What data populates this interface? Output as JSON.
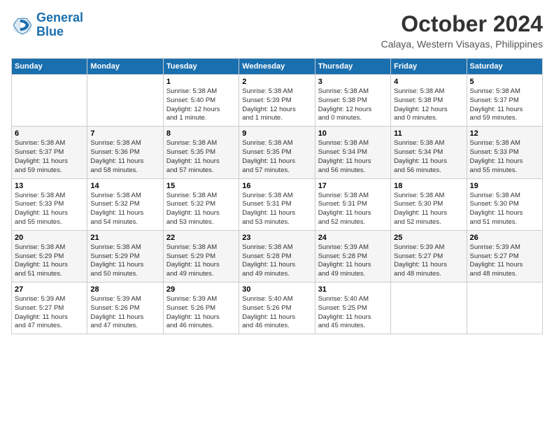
{
  "header": {
    "logo_line1": "General",
    "logo_line2": "Blue",
    "month_year": "October 2024",
    "location": "Calaya, Western Visayas, Philippines"
  },
  "weekdays": [
    "Sunday",
    "Monday",
    "Tuesday",
    "Wednesday",
    "Thursday",
    "Friday",
    "Saturday"
  ],
  "weeks": [
    [
      {
        "day": "",
        "info": ""
      },
      {
        "day": "",
        "info": ""
      },
      {
        "day": "1",
        "info": "Sunrise: 5:38 AM\nSunset: 5:40 PM\nDaylight: 12 hours\nand 1 minute."
      },
      {
        "day": "2",
        "info": "Sunrise: 5:38 AM\nSunset: 5:39 PM\nDaylight: 12 hours\nand 1 minute."
      },
      {
        "day": "3",
        "info": "Sunrise: 5:38 AM\nSunset: 5:38 PM\nDaylight: 12 hours\nand 0 minutes."
      },
      {
        "day": "4",
        "info": "Sunrise: 5:38 AM\nSunset: 5:38 PM\nDaylight: 12 hours\nand 0 minutes."
      },
      {
        "day": "5",
        "info": "Sunrise: 5:38 AM\nSunset: 5:37 PM\nDaylight: 11 hours\nand 59 minutes."
      }
    ],
    [
      {
        "day": "6",
        "info": "Sunrise: 5:38 AM\nSunset: 5:37 PM\nDaylight: 11 hours\nand 59 minutes."
      },
      {
        "day": "7",
        "info": "Sunrise: 5:38 AM\nSunset: 5:36 PM\nDaylight: 11 hours\nand 58 minutes."
      },
      {
        "day": "8",
        "info": "Sunrise: 5:38 AM\nSunset: 5:35 PM\nDaylight: 11 hours\nand 57 minutes."
      },
      {
        "day": "9",
        "info": "Sunrise: 5:38 AM\nSunset: 5:35 PM\nDaylight: 11 hours\nand 57 minutes."
      },
      {
        "day": "10",
        "info": "Sunrise: 5:38 AM\nSunset: 5:34 PM\nDaylight: 11 hours\nand 56 minutes."
      },
      {
        "day": "11",
        "info": "Sunrise: 5:38 AM\nSunset: 5:34 PM\nDaylight: 11 hours\nand 56 minutes."
      },
      {
        "day": "12",
        "info": "Sunrise: 5:38 AM\nSunset: 5:33 PM\nDaylight: 11 hours\nand 55 minutes."
      }
    ],
    [
      {
        "day": "13",
        "info": "Sunrise: 5:38 AM\nSunset: 5:33 PM\nDaylight: 11 hours\nand 55 minutes."
      },
      {
        "day": "14",
        "info": "Sunrise: 5:38 AM\nSunset: 5:32 PM\nDaylight: 11 hours\nand 54 minutes."
      },
      {
        "day": "15",
        "info": "Sunrise: 5:38 AM\nSunset: 5:32 PM\nDaylight: 11 hours\nand 53 minutes."
      },
      {
        "day": "16",
        "info": "Sunrise: 5:38 AM\nSunset: 5:31 PM\nDaylight: 11 hours\nand 53 minutes."
      },
      {
        "day": "17",
        "info": "Sunrise: 5:38 AM\nSunset: 5:31 PM\nDaylight: 11 hours\nand 52 minutes."
      },
      {
        "day": "18",
        "info": "Sunrise: 5:38 AM\nSunset: 5:30 PM\nDaylight: 11 hours\nand 52 minutes."
      },
      {
        "day": "19",
        "info": "Sunrise: 5:38 AM\nSunset: 5:30 PM\nDaylight: 11 hours\nand 51 minutes."
      }
    ],
    [
      {
        "day": "20",
        "info": "Sunrise: 5:38 AM\nSunset: 5:29 PM\nDaylight: 11 hours\nand 51 minutes."
      },
      {
        "day": "21",
        "info": "Sunrise: 5:38 AM\nSunset: 5:29 PM\nDaylight: 11 hours\nand 50 minutes."
      },
      {
        "day": "22",
        "info": "Sunrise: 5:38 AM\nSunset: 5:29 PM\nDaylight: 11 hours\nand 49 minutes."
      },
      {
        "day": "23",
        "info": "Sunrise: 5:38 AM\nSunset: 5:28 PM\nDaylight: 11 hours\nand 49 minutes."
      },
      {
        "day": "24",
        "info": "Sunrise: 5:39 AM\nSunset: 5:28 PM\nDaylight: 11 hours\nand 49 minutes."
      },
      {
        "day": "25",
        "info": "Sunrise: 5:39 AM\nSunset: 5:27 PM\nDaylight: 11 hours\nand 48 minutes."
      },
      {
        "day": "26",
        "info": "Sunrise: 5:39 AM\nSunset: 5:27 PM\nDaylight: 11 hours\nand 48 minutes."
      }
    ],
    [
      {
        "day": "27",
        "info": "Sunrise: 5:39 AM\nSunset: 5:27 PM\nDaylight: 11 hours\nand 47 minutes."
      },
      {
        "day": "28",
        "info": "Sunrise: 5:39 AM\nSunset: 5:26 PM\nDaylight: 11 hours\nand 47 minutes."
      },
      {
        "day": "29",
        "info": "Sunrise: 5:39 AM\nSunset: 5:26 PM\nDaylight: 11 hours\nand 46 minutes."
      },
      {
        "day": "30",
        "info": "Sunrise: 5:40 AM\nSunset: 5:26 PM\nDaylight: 11 hours\nand 46 minutes."
      },
      {
        "day": "31",
        "info": "Sunrise: 5:40 AM\nSunset: 5:25 PM\nDaylight: 11 hours\nand 45 minutes."
      },
      {
        "day": "",
        "info": ""
      },
      {
        "day": "",
        "info": ""
      }
    ]
  ]
}
